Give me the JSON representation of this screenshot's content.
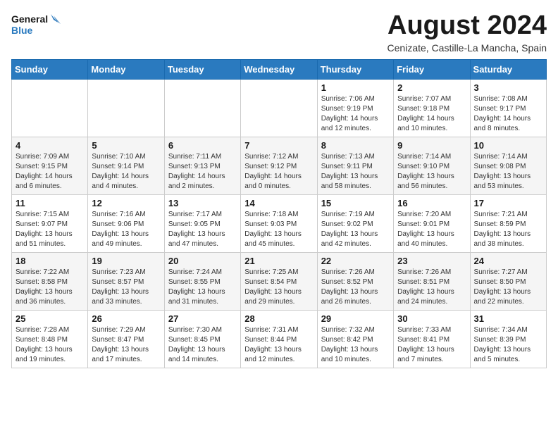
{
  "logo": {
    "line1": "General",
    "line2": "Blue"
  },
  "title": "August 2024",
  "subtitle": "Cenizate, Castille-La Mancha, Spain",
  "days_of_week": [
    "Sunday",
    "Monday",
    "Tuesday",
    "Wednesday",
    "Thursday",
    "Friday",
    "Saturday"
  ],
  "weeks": [
    [
      {
        "day": "",
        "info": ""
      },
      {
        "day": "",
        "info": ""
      },
      {
        "day": "",
        "info": ""
      },
      {
        "day": "",
        "info": ""
      },
      {
        "day": "1",
        "info": "Sunrise: 7:06 AM\nSunset: 9:19 PM\nDaylight: 14 hours\nand 12 minutes."
      },
      {
        "day": "2",
        "info": "Sunrise: 7:07 AM\nSunset: 9:18 PM\nDaylight: 14 hours\nand 10 minutes."
      },
      {
        "day": "3",
        "info": "Sunrise: 7:08 AM\nSunset: 9:17 PM\nDaylight: 14 hours\nand 8 minutes."
      }
    ],
    [
      {
        "day": "4",
        "info": "Sunrise: 7:09 AM\nSunset: 9:15 PM\nDaylight: 14 hours\nand 6 minutes."
      },
      {
        "day": "5",
        "info": "Sunrise: 7:10 AM\nSunset: 9:14 PM\nDaylight: 14 hours\nand 4 minutes."
      },
      {
        "day": "6",
        "info": "Sunrise: 7:11 AM\nSunset: 9:13 PM\nDaylight: 14 hours\nand 2 minutes."
      },
      {
        "day": "7",
        "info": "Sunrise: 7:12 AM\nSunset: 9:12 PM\nDaylight: 14 hours\nand 0 minutes."
      },
      {
        "day": "8",
        "info": "Sunrise: 7:13 AM\nSunset: 9:11 PM\nDaylight: 13 hours\nand 58 minutes."
      },
      {
        "day": "9",
        "info": "Sunrise: 7:14 AM\nSunset: 9:10 PM\nDaylight: 13 hours\nand 56 minutes."
      },
      {
        "day": "10",
        "info": "Sunrise: 7:14 AM\nSunset: 9:08 PM\nDaylight: 13 hours\nand 53 minutes."
      }
    ],
    [
      {
        "day": "11",
        "info": "Sunrise: 7:15 AM\nSunset: 9:07 PM\nDaylight: 13 hours\nand 51 minutes."
      },
      {
        "day": "12",
        "info": "Sunrise: 7:16 AM\nSunset: 9:06 PM\nDaylight: 13 hours\nand 49 minutes."
      },
      {
        "day": "13",
        "info": "Sunrise: 7:17 AM\nSunset: 9:05 PM\nDaylight: 13 hours\nand 47 minutes."
      },
      {
        "day": "14",
        "info": "Sunrise: 7:18 AM\nSunset: 9:03 PM\nDaylight: 13 hours\nand 45 minutes."
      },
      {
        "day": "15",
        "info": "Sunrise: 7:19 AM\nSunset: 9:02 PM\nDaylight: 13 hours\nand 42 minutes."
      },
      {
        "day": "16",
        "info": "Sunrise: 7:20 AM\nSunset: 9:01 PM\nDaylight: 13 hours\nand 40 minutes."
      },
      {
        "day": "17",
        "info": "Sunrise: 7:21 AM\nSunset: 8:59 PM\nDaylight: 13 hours\nand 38 minutes."
      }
    ],
    [
      {
        "day": "18",
        "info": "Sunrise: 7:22 AM\nSunset: 8:58 PM\nDaylight: 13 hours\nand 36 minutes."
      },
      {
        "day": "19",
        "info": "Sunrise: 7:23 AM\nSunset: 8:57 PM\nDaylight: 13 hours\nand 33 minutes."
      },
      {
        "day": "20",
        "info": "Sunrise: 7:24 AM\nSunset: 8:55 PM\nDaylight: 13 hours\nand 31 minutes."
      },
      {
        "day": "21",
        "info": "Sunrise: 7:25 AM\nSunset: 8:54 PM\nDaylight: 13 hours\nand 29 minutes."
      },
      {
        "day": "22",
        "info": "Sunrise: 7:26 AM\nSunset: 8:52 PM\nDaylight: 13 hours\nand 26 minutes."
      },
      {
        "day": "23",
        "info": "Sunrise: 7:26 AM\nSunset: 8:51 PM\nDaylight: 13 hours\nand 24 minutes."
      },
      {
        "day": "24",
        "info": "Sunrise: 7:27 AM\nSunset: 8:50 PM\nDaylight: 13 hours\nand 22 minutes."
      }
    ],
    [
      {
        "day": "25",
        "info": "Sunrise: 7:28 AM\nSunset: 8:48 PM\nDaylight: 13 hours\nand 19 minutes."
      },
      {
        "day": "26",
        "info": "Sunrise: 7:29 AM\nSunset: 8:47 PM\nDaylight: 13 hours\nand 17 minutes."
      },
      {
        "day": "27",
        "info": "Sunrise: 7:30 AM\nSunset: 8:45 PM\nDaylight: 13 hours\nand 14 minutes."
      },
      {
        "day": "28",
        "info": "Sunrise: 7:31 AM\nSunset: 8:44 PM\nDaylight: 13 hours\nand 12 minutes."
      },
      {
        "day": "29",
        "info": "Sunrise: 7:32 AM\nSunset: 8:42 PM\nDaylight: 13 hours\nand 10 minutes."
      },
      {
        "day": "30",
        "info": "Sunrise: 7:33 AM\nSunset: 8:41 PM\nDaylight: 13 hours\nand 7 minutes."
      },
      {
        "day": "31",
        "info": "Sunrise: 7:34 AM\nSunset: 8:39 PM\nDaylight: 13 hours\nand 5 minutes."
      }
    ]
  ]
}
